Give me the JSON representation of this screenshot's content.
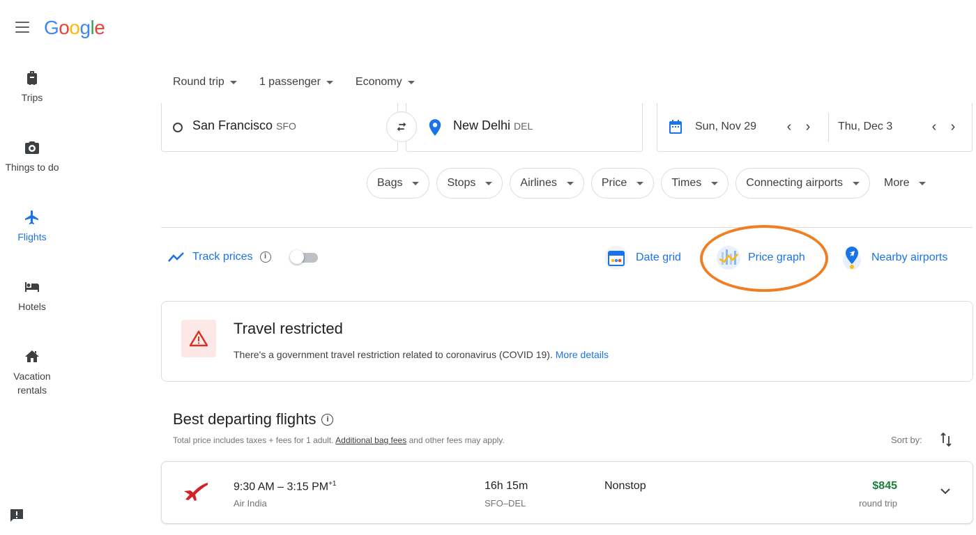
{
  "header": {
    "logo_letters": [
      {
        "ch": "G",
        "color": "#4285f4"
      },
      {
        "ch": "o",
        "color": "#ea4335"
      },
      {
        "ch": "o",
        "color": "#fbbc05"
      },
      {
        "ch": "g",
        "color": "#4285f4"
      },
      {
        "ch": "l",
        "color": "#34a853"
      },
      {
        "ch": "e",
        "color": "#ea4335"
      }
    ]
  },
  "sidebar": {
    "items": [
      {
        "label": "Trips",
        "icon": "luggage-icon"
      },
      {
        "label": "Things to do",
        "icon": "camera-icon"
      },
      {
        "label": "Flights",
        "icon": "airplane-icon",
        "active": true
      },
      {
        "label": "Hotels",
        "icon": "bed-icon"
      },
      {
        "label": "Vacation rentals",
        "label_lines": [
          "Vacation",
          "rentals"
        ],
        "icon": "house-icon"
      }
    ]
  },
  "search": {
    "trip_type": "Round trip",
    "passengers": "1 passenger",
    "cabin": "Economy",
    "from": {
      "city": "San Francisco",
      "code": "SFO"
    },
    "to": {
      "city": "New Delhi",
      "code": "DEL"
    },
    "depart_date": "Sun, Nov 29",
    "return_date": "Thu, Dec 3",
    "chevron_left": "‹",
    "chevron_right": "›"
  },
  "filters": {
    "chips": [
      "Bags",
      "Stops",
      "Airlines",
      "Price",
      "Times",
      "Connecting airports"
    ],
    "more": "More"
  },
  "tools": {
    "track_prices": "Track prices",
    "track_on": false,
    "date_grid": "Date grid",
    "price_graph": "Price graph",
    "nearby_airports": "Nearby airports",
    "highlight_color": "#ee7f25"
  },
  "restriction": {
    "title": "Travel restricted",
    "description": "There's a government travel restriction related to coronavirus (COVID 19).",
    "link": "More details"
  },
  "results": {
    "title": "Best departing flights",
    "subtitle_prefix": "Total price includes taxes + fees for 1 adult.",
    "subtitle_link": "Additional bag fees",
    "subtitle_suffix": "and other fees may apply.",
    "sort_label": "Sort by:",
    "flights": [
      {
        "times": "9:30 AM – 3:15 PM",
        "day_offset": "+1",
        "airline": "Air India",
        "duration": "16h 15m",
        "route": "SFO–DEL",
        "stops": "Nonstop",
        "price": "$845",
        "price_type": "round trip"
      }
    ]
  },
  "colors": {
    "accent": "#1a73e8",
    "price_green": "#188038",
    "warning_red": "#d93025"
  }
}
